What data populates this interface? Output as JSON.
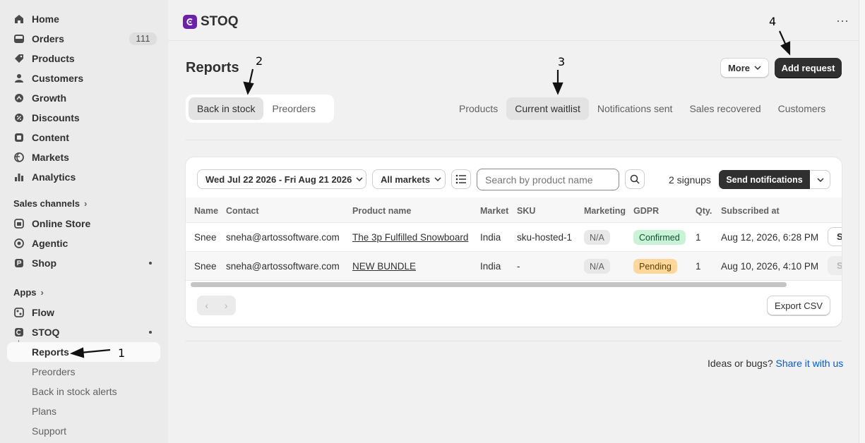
{
  "sidebar": {
    "items": [
      {
        "label": "Home",
        "icon": "home-icon"
      },
      {
        "label": "Orders",
        "icon": "orders-icon",
        "badge": "111"
      },
      {
        "label": "Products",
        "icon": "tag-icon"
      },
      {
        "label": "Customers",
        "icon": "person-icon"
      },
      {
        "label": "Growth",
        "icon": "growth-icon"
      },
      {
        "label": "Discounts",
        "icon": "discount-icon"
      },
      {
        "label": "Content",
        "icon": "content-icon"
      },
      {
        "label": "Markets",
        "icon": "globe-icon"
      },
      {
        "label": "Analytics",
        "icon": "analytics-icon"
      }
    ],
    "sales_channels_title": "Sales channels",
    "channels": [
      {
        "label": "Online Store",
        "icon": "store-icon"
      },
      {
        "label": "Agentic",
        "icon": "agentic-icon"
      },
      {
        "label": "Shop",
        "icon": "shop-icon"
      }
    ],
    "apps_title": "Apps",
    "apps": [
      {
        "label": "Flow",
        "icon": "flow-icon"
      },
      {
        "label": "STOQ",
        "icon": "stoq-icon"
      }
    ],
    "sub_items": [
      {
        "label": "Reports"
      },
      {
        "label": "Preorders"
      },
      {
        "label": "Back in stock alerts"
      },
      {
        "label": "Plans"
      },
      {
        "label": "Support"
      }
    ]
  },
  "header": {
    "app_name": "STOQ",
    "more_menu": "⋯"
  },
  "page": {
    "title": "Reports",
    "more_label": "More",
    "add_request_label": "Add request",
    "segments": [
      "Back in stock",
      "Preorders"
    ],
    "tabs": [
      "Products",
      "Current waitlist",
      "Notifications sent",
      "Sales recovered",
      "Customers"
    ]
  },
  "filters": {
    "date_range": "Wed Jul 22 2026 - Fri Aug 21 2026",
    "market": "All markets",
    "search_placeholder": "Search by product name",
    "signups": "2 signups",
    "send_label": "Send notifications"
  },
  "table": {
    "columns": [
      "Name",
      "Contact",
      "Product name",
      "Market",
      "SKU",
      "Marketing",
      "GDPR",
      "Qty.",
      "Subscribed at"
    ],
    "rows": [
      {
        "name": "Snee",
        "contact": "sneha@artossoftware.com",
        "product": "The 3p Fulfilled Snowboard",
        "market": "India",
        "sku": "sku-hosted-1",
        "marketing": "N/A",
        "gdpr": "Confirmed",
        "qty": "1",
        "subscribed": "Aug 12, 2026, 6:28 PM",
        "action": "S"
      },
      {
        "name": "Snee",
        "contact": "sneha@artossoftware.com",
        "product": "NEW BUNDLE",
        "market": "India",
        "sku": "-",
        "marketing": "N/A",
        "gdpr": "Pending",
        "qty": "1",
        "subscribed": "Aug 10, 2026, 4:10 PM",
        "action": "S"
      }
    ]
  },
  "pager": {
    "prev": "‹",
    "next": "›"
  },
  "export_label": "Export CSV",
  "footer": {
    "text": "Ideas or bugs?",
    "link": "Share it with us"
  },
  "annotations": [
    "1",
    "2",
    "3",
    "4"
  ],
  "colors": {
    "accent": "#303030",
    "brand": "#6b21a8",
    "link": "#005bd3",
    "confirmed_bg": "#c9f2d6",
    "pending_bg": "#ffd79d"
  }
}
